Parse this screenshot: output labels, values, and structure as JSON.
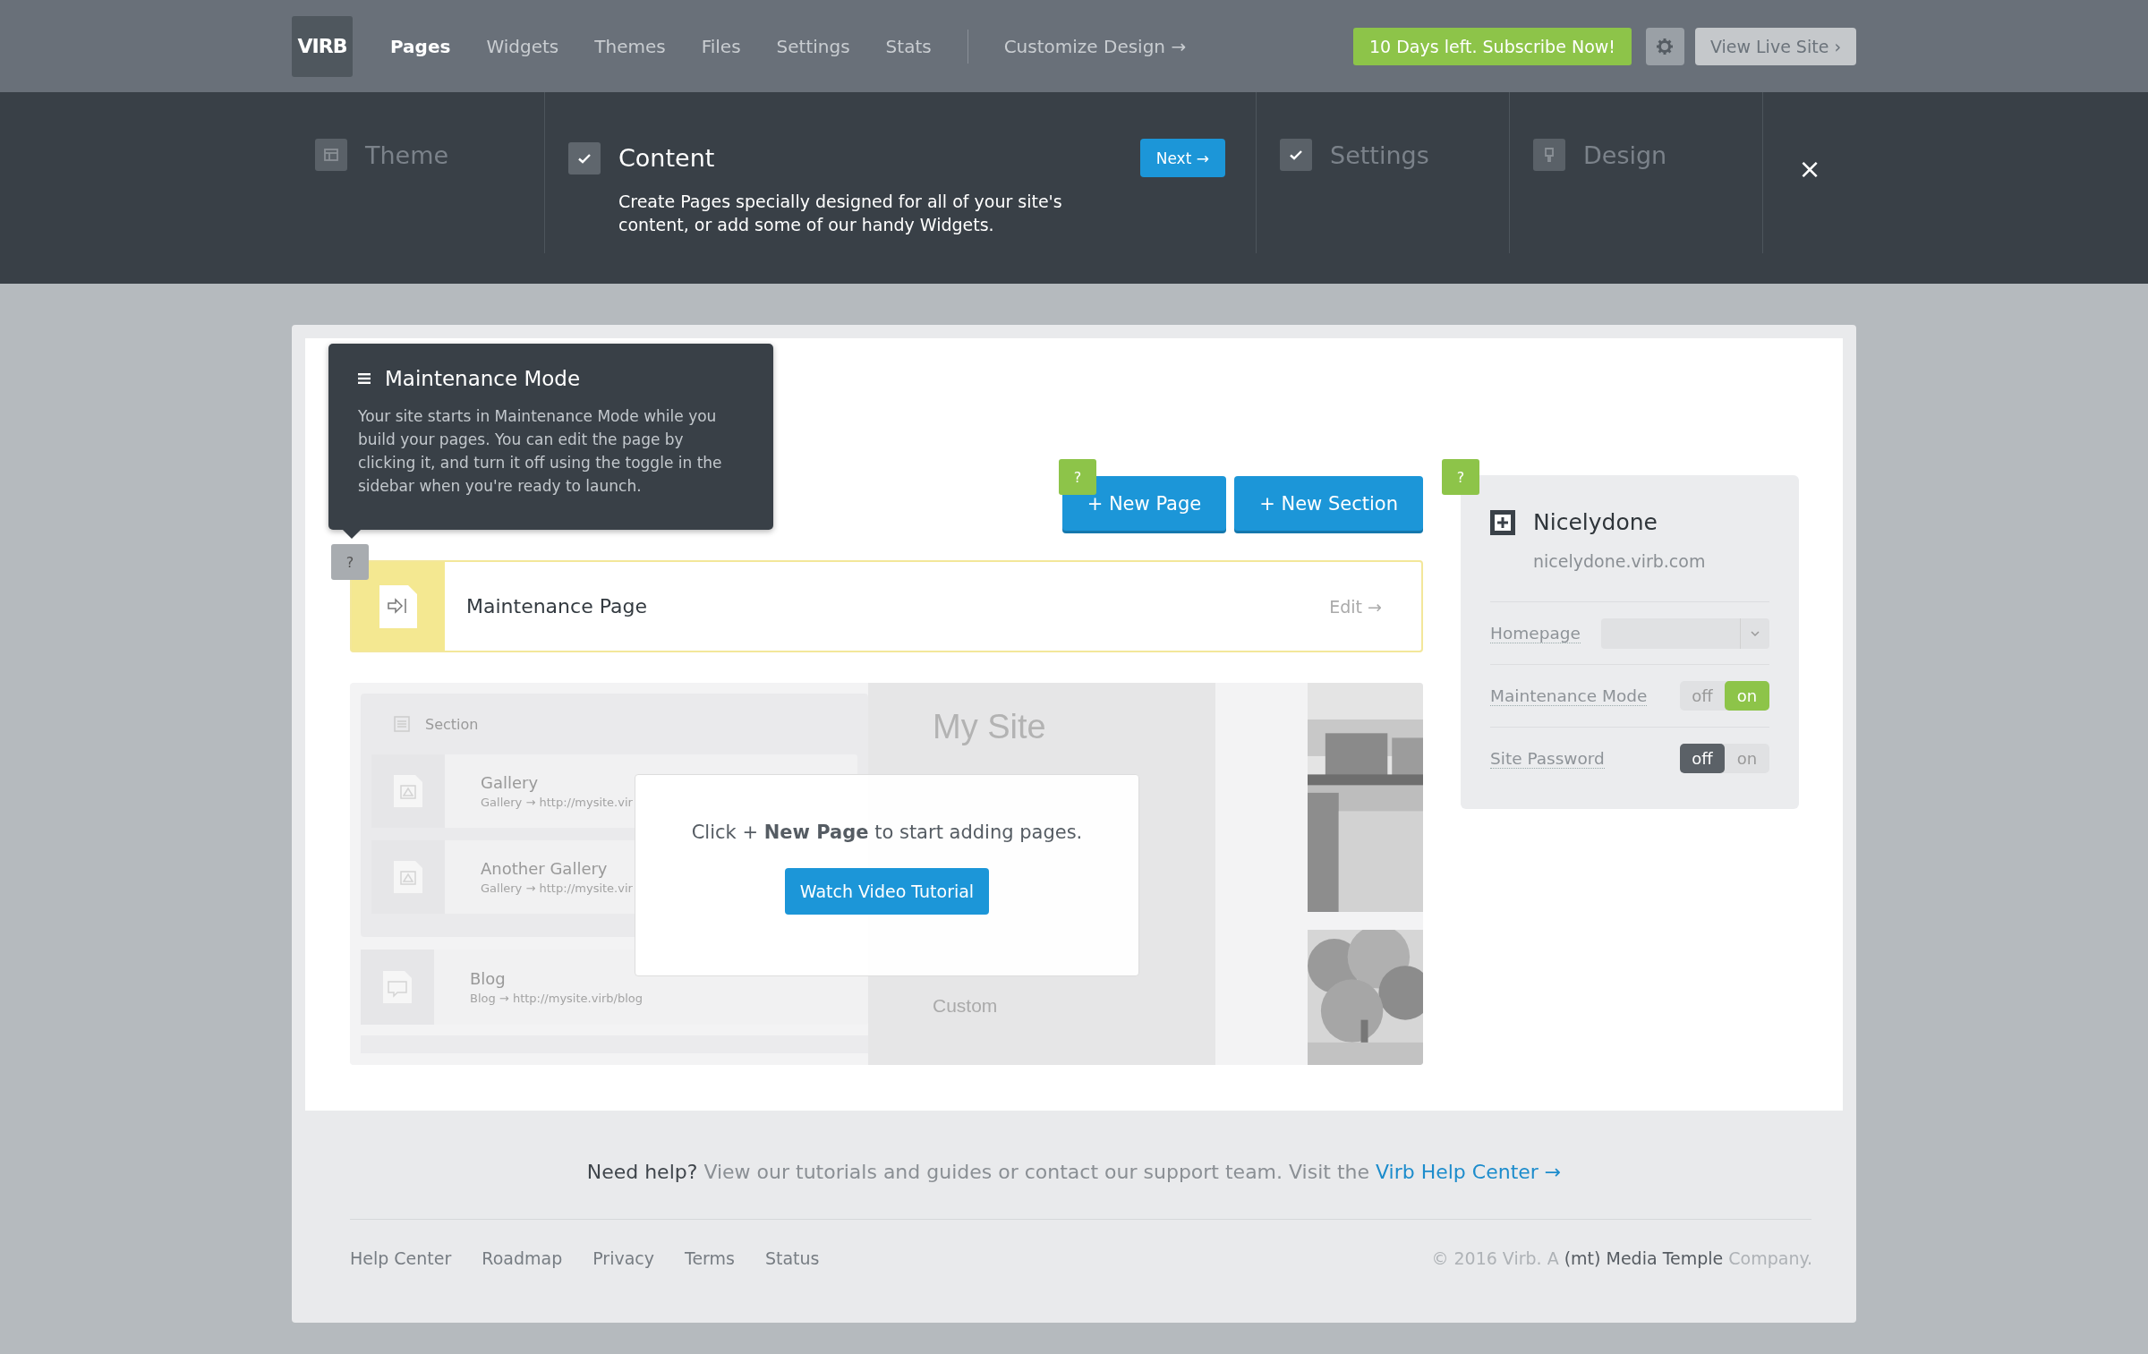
{
  "topbar": {
    "logo": "VIRB",
    "nav": [
      {
        "label": "Pages",
        "selected": true
      },
      {
        "label": "Widgets",
        "selected": false
      },
      {
        "label": "Themes",
        "selected": false
      },
      {
        "label": "Files",
        "selected": false
      },
      {
        "label": "Settings",
        "selected": false
      },
      {
        "label": "Stats",
        "selected": false
      }
    ],
    "customize": "Customize Design →",
    "trial": "10 Days left. Subscribe Now!",
    "view_site": "View Live Site ›"
  },
  "steps": [
    {
      "title": "Theme",
      "kind": "layout",
      "active": false
    },
    {
      "title": "Content",
      "kind": "check",
      "active": true,
      "description": "Create Pages specially designed for all of your site's content, or add some of our handy Widgets.",
      "next": "Next →"
    },
    {
      "title": "Settings",
      "kind": "check",
      "active": false
    },
    {
      "title": "Design",
      "kind": "brush",
      "active": false
    }
  ],
  "close": "×",
  "tooltip": {
    "title": "Maintenance Mode",
    "body": "Your site starts in Maintenance Mode while you build your pages. You can edit the page by clicking it, and turn it off using the toggle in the sidebar when you're ready to launch.",
    "help": "?"
  },
  "actions": {
    "help": "?",
    "buttons": [
      "+  New Page",
      "+  New Section"
    ]
  },
  "page_row": {
    "title": "Maintenance Page",
    "edit": "Edit →"
  },
  "preview": {
    "section": "Section",
    "items": [
      {
        "title": "Gallery",
        "url": "Gallery → http://mysite.vir",
        "kind": "gallery"
      },
      {
        "title": "Another Gallery",
        "url": "Gallery → http://mysite.vir",
        "kind": "gallery"
      },
      {
        "title": "Blog",
        "url": "Blog → http://mysite.virb/blog",
        "kind": "blog"
      }
    ],
    "site_name": "My Site",
    "nav": [
      "Custom"
    ],
    "dialog": {
      "text": "Click + **New Page** to start adding pages.",
      "button": "Watch Video Tutorial"
    }
  },
  "sidebar": {
    "help": "?",
    "site": "Nicelydone",
    "url": "nicelydone.virb.com",
    "homepage": "Homepage",
    "toggles": [
      {
        "label": "Maintenance Mode",
        "off": "off",
        "on": "on",
        "value": true
      },
      {
        "label": "Site Password",
        "off": "off",
        "on": "on",
        "value": false
      }
    ]
  },
  "footer": {
    "help_lead": "Need help?",
    "help_text": "View our tutorials and guides or contact our support team. Visit the",
    "help_link": "Virb Help Center →",
    "links": [
      "Help Center",
      "Roadmap",
      "Privacy",
      "Terms",
      "Status"
    ],
    "copyright": "© 2016 Virb. A **(mt) Media Temple** Company."
  }
}
